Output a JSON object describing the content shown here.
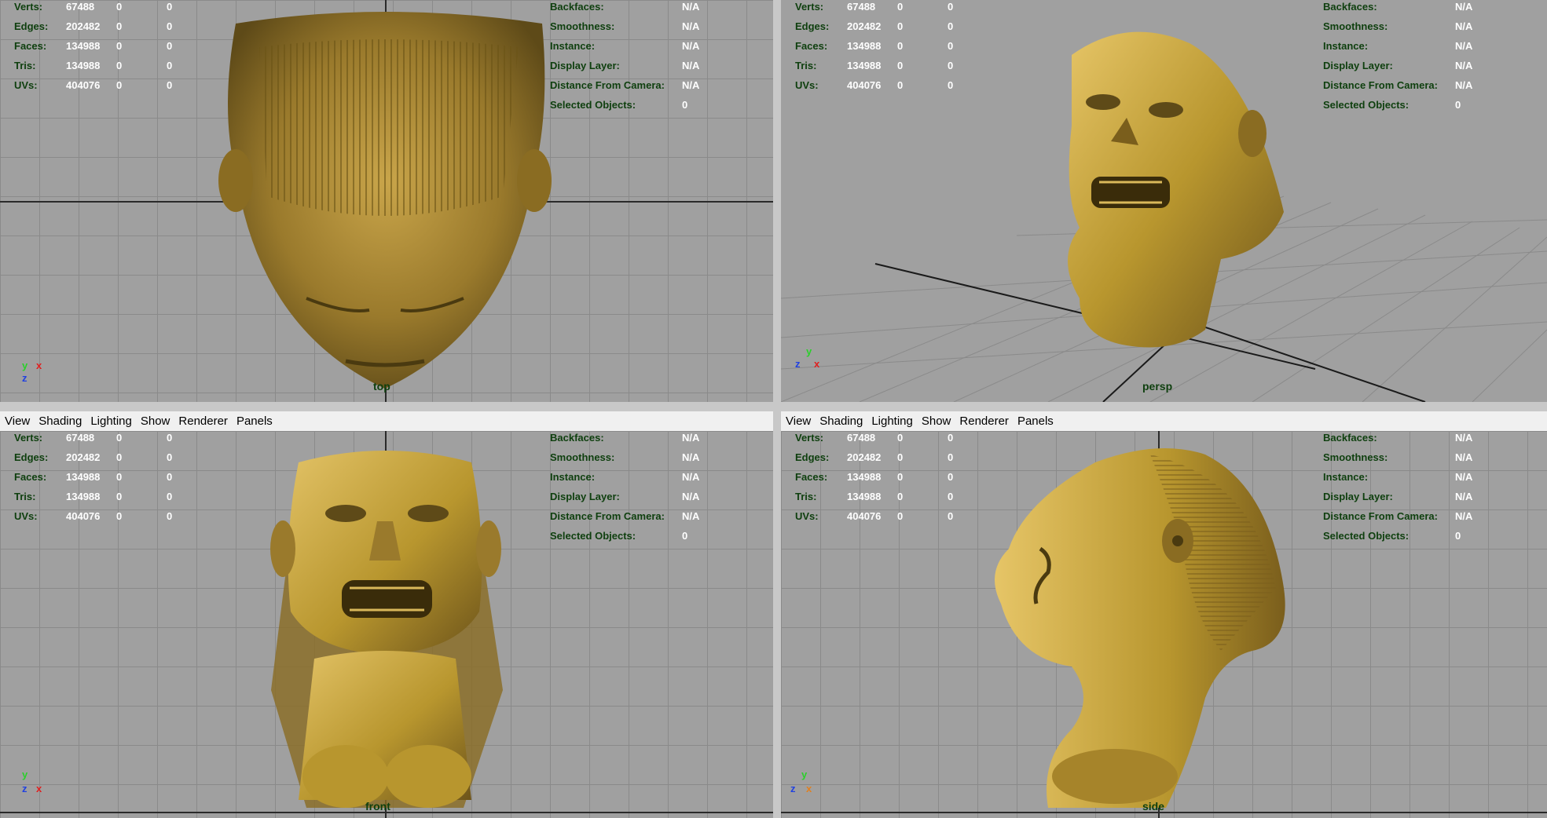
{
  "menu": [
    "View",
    "Shading",
    "Lighting",
    "Show",
    "Renderer",
    "Panels"
  ],
  "hud_left": [
    {
      "label": "Verts:",
      "value": "67488",
      "c1": "0",
      "c2": "0"
    },
    {
      "label": "Edges:",
      "value": "202482",
      "c1": "0",
      "c2": "0"
    },
    {
      "label": "Faces:",
      "value": "134988",
      "c1": "0",
      "c2": "0"
    },
    {
      "label": "Tris:",
      "value": "134988",
      "c1": "0",
      "c2": "0"
    },
    {
      "label": "UVs:",
      "value": "404076",
      "c1": "0",
      "c2": "0"
    }
  ],
  "hud_right": [
    {
      "label": "Backfaces:",
      "value": "N/A"
    },
    {
      "label": "Smoothness:",
      "value": "N/A"
    },
    {
      "label": "Instance:",
      "value": "N/A"
    },
    {
      "label": "Display Layer:",
      "value": "N/A"
    },
    {
      "label": "Distance From Camera:",
      "value": "N/A"
    },
    {
      "label": "Selected Objects:",
      "value": "0"
    }
  ],
  "cameras": {
    "top": "top",
    "persp": "persp",
    "front": "front",
    "side": "side"
  },
  "axes": {
    "x": "x",
    "y": "y",
    "z": "z"
  },
  "colors": {
    "viewport_bg": "#a0a0a0",
    "hud_label": "#0e3f0e",
    "gold": "#b8962e"
  }
}
